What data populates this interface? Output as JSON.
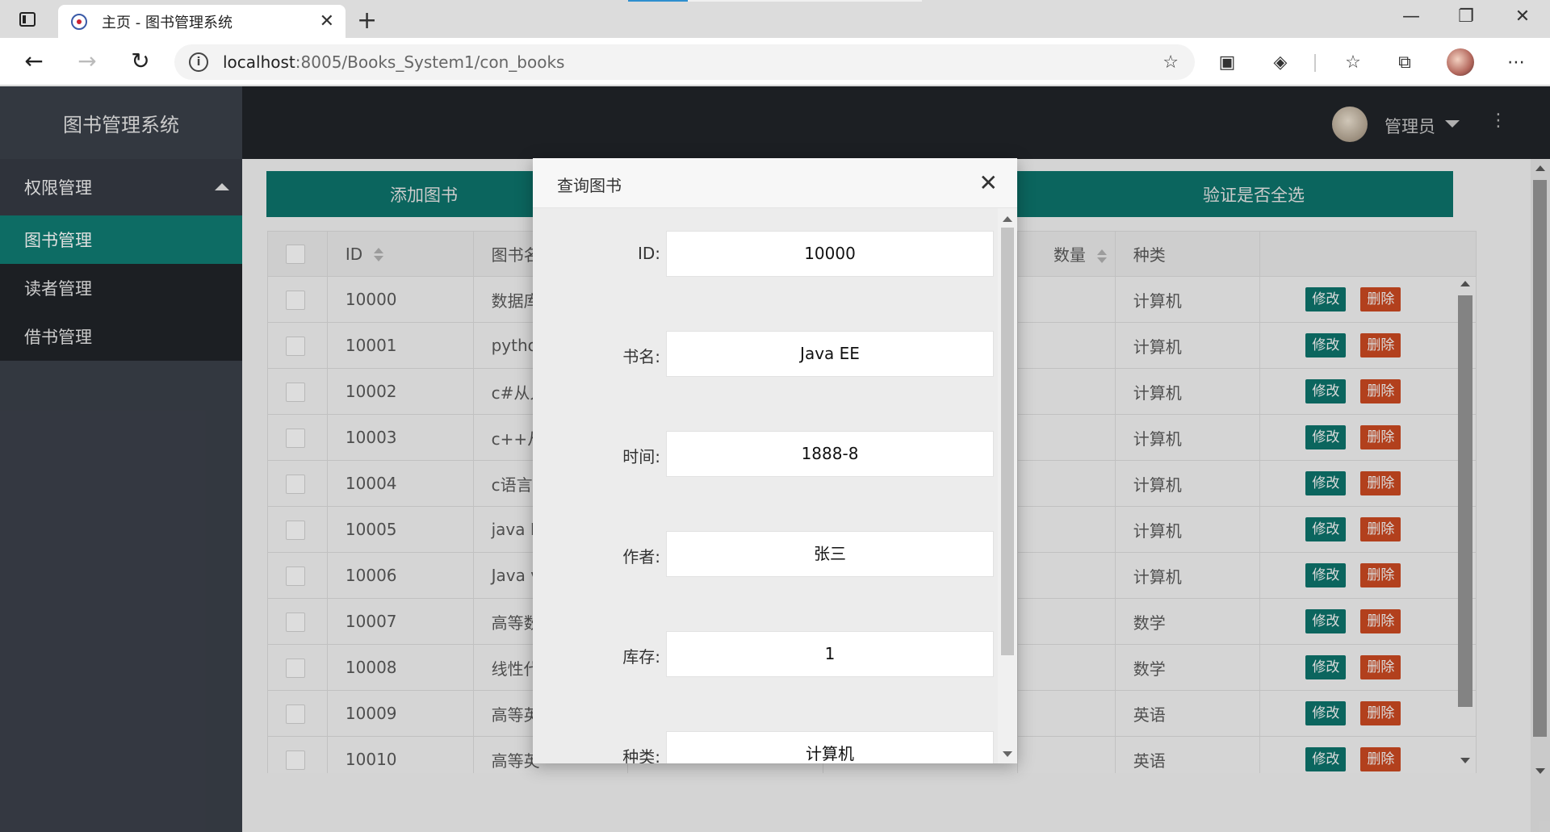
{
  "browser": {
    "tab_title": "主页 - 图书管理系统",
    "url_host": "localhost",
    "url_rest": ":8005/Books_System1/con_books"
  },
  "sidebar": {
    "brand": "图书管理系统",
    "group": "权限管理",
    "items": [
      "图书管理",
      "读者管理",
      "借书管理"
    ]
  },
  "header": {
    "user": "管理员"
  },
  "toolbar": {
    "add": "添加图书",
    "check_all": "验证是否全选"
  },
  "table": {
    "headers": [
      "ID",
      "图书名",
      "数量",
      "种类"
    ],
    "rows": [
      {
        "id": "10000",
        "name": "数据库",
        "cat": "计算机"
      },
      {
        "id": "10001",
        "name": "pytho",
        "cat": "计算机"
      },
      {
        "id": "10002",
        "name": "c#从入",
        "cat": "计算机"
      },
      {
        "id": "10003",
        "name": "c++从",
        "cat": "计算机"
      },
      {
        "id": "10004",
        "name": "c语言",
        "cat": "计算机"
      },
      {
        "id": "10005",
        "name": "java E",
        "cat": "计算机"
      },
      {
        "id": "10006",
        "name": "Java v",
        "cat": "计算机"
      },
      {
        "id": "10007",
        "name": "高等数",
        "cat": "数学"
      },
      {
        "id": "10008",
        "name": "线性代",
        "cat": "数学"
      },
      {
        "id": "10009",
        "name": "高等英",
        "cat": "英语"
      },
      {
        "id": "10010",
        "name": "高等英",
        "cat": "英语"
      }
    ],
    "edit_label": "修改",
    "delete_label": "删除"
  },
  "modal": {
    "title": "查询图书",
    "fields": [
      {
        "label": "ID:",
        "value": "10000"
      },
      {
        "label": "书名:",
        "value": "Java EE"
      },
      {
        "label": "时间:",
        "value": "1888-8"
      },
      {
        "label": "作者:",
        "value": "张三"
      },
      {
        "label": "库存:",
        "value": "1"
      },
      {
        "label": "种类:",
        "value": "计算机"
      }
    ]
  }
}
